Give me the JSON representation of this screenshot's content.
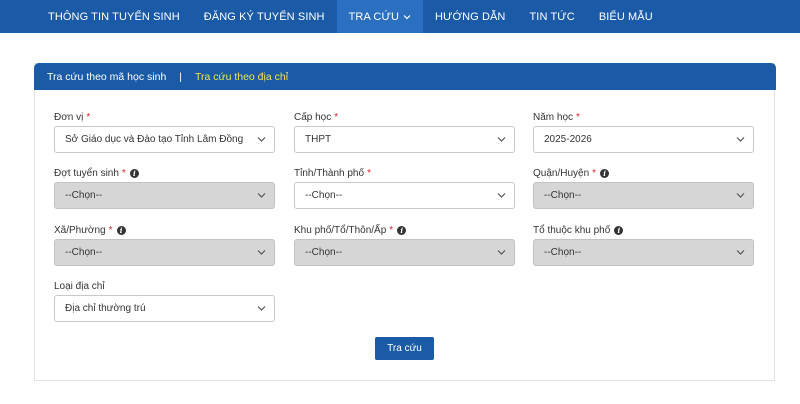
{
  "nav": {
    "items": [
      {
        "label": "THÔNG TIN TUYỂN SINH"
      },
      {
        "label": "ĐĂNG KÝ TUYỂN SINH"
      },
      {
        "label": "TRA CỨU"
      },
      {
        "label": "HƯỚNG DẪN"
      },
      {
        "label": "TIN TỨC"
      },
      {
        "label": "BIỂU MẪU"
      }
    ]
  },
  "tabs": {
    "by_student_code": "Tra cứu theo mã học sinh",
    "separator": "|",
    "by_address": "Tra cứu theo địa chỉ"
  },
  "form": {
    "required_mark": "*",
    "don_vi": {
      "label": "Đơn vị",
      "value": "Sở Giáo dục và Đào tạo Tỉnh Lâm Đồng"
    },
    "cap_hoc": {
      "label": "Cấp học",
      "value": "THPT"
    },
    "nam_hoc": {
      "label": "Năm học",
      "value": "2025-2026"
    },
    "dot_tuyen_sinh": {
      "label": "Đợt tuyển sinh",
      "value": "--Chọn--"
    },
    "tinh_thanh_pho": {
      "label": "Tỉnh/Thành phố",
      "value": "--Chọn--"
    },
    "quan_huyen": {
      "label": "Quận/Huyện",
      "value": "--Chọn--"
    },
    "xa_phuong": {
      "label": "Xã/Phường",
      "value": "--Chọn--"
    },
    "khu_pho": {
      "label": "Khu phố/Tổ/Thôn/Ấp",
      "value": "--Chọn--"
    },
    "to_thuoc_khu_pho": {
      "label": "Tổ thuộc khu phố",
      "value": "--Chọn--"
    },
    "loai_dia_chi": {
      "label": "Loại địa chỉ",
      "value": "Địa chỉ thường trú"
    },
    "submit_label": "Tra cứu"
  },
  "colors": {
    "primary": "#1a5aa6",
    "active_tab": "#f2e44d",
    "required": "#d9232d",
    "disabled_bg": "#d6d6d6"
  }
}
